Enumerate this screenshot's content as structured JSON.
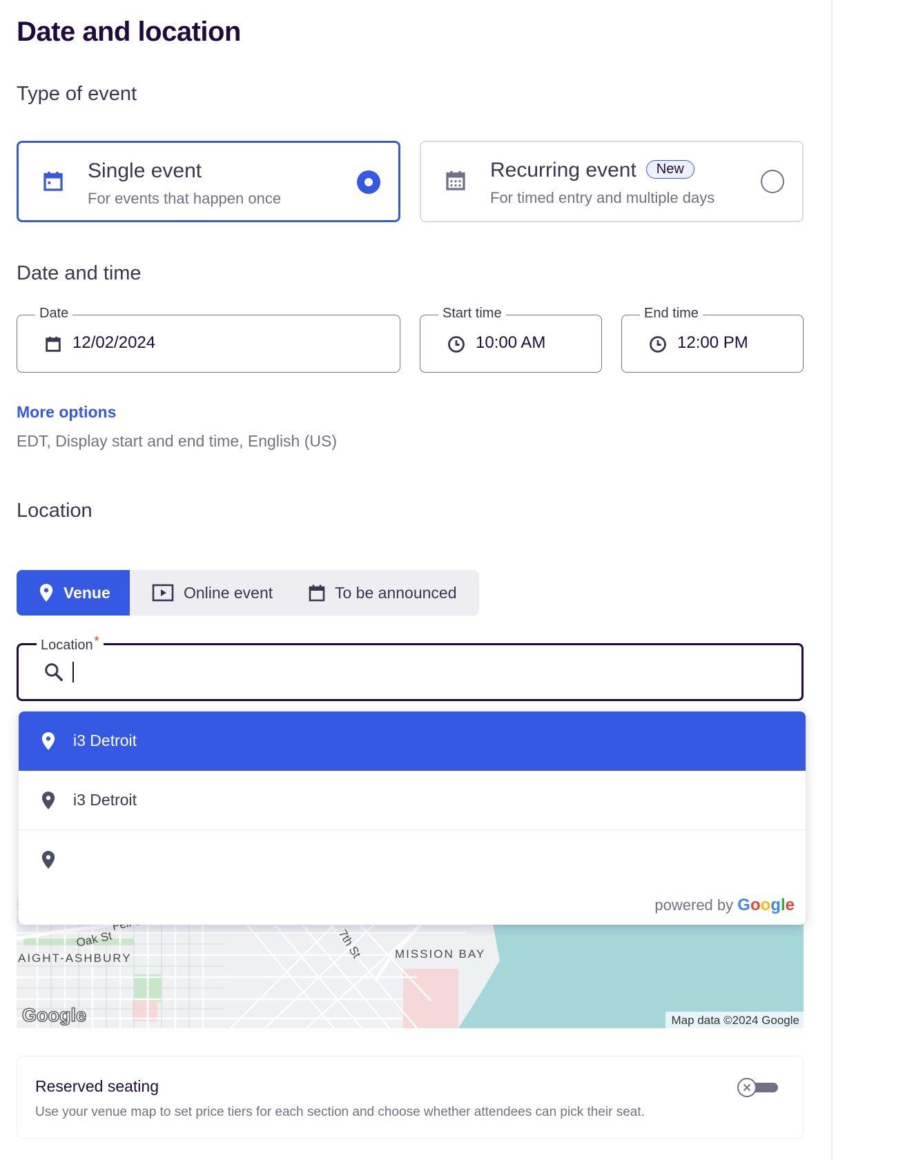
{
  "page": {
    "title": "Date and location"
  },
  "event_type": {
    "section_title": "Type of event",
    "options": [
      {
        "title": "Single event",
        "subtitle": "For events that happen once",
        "selected": true
      },
      {
        "title": "Recurring event",
        "badge": "New",
        "subtitle": "For timed entry and multiple days",
        "selected": false
      }
    ]
  },
  "date_time": {
    "section_title": "Date and time",
    "date": {
      "label": "Date",
      "value": "12/02/2024"
    },
    "start_time": {
      "label": "Start time",
      "value": "10:00 AM"
    },
    "end_time": {
      "label": "End time",
      "value": "12:00 PM"
    },
    "more_options": "More options",
    "summary": "EDT, Display start and end time, English (US)"
  },
  "location": {
    "section_title": "Location",
    "tabs": [
      {
        "label": "Venue",
        "active": true,
        "icon": "pin-icon"
      },
      {
        "label": "Online event",
        "active": false,
        "icon": "video-icon"
      },
      {
        "label": "To be announced",
        "active": false,
        "icon": "calendar-icon"
      }
    ],
    "input": {
      "label": "Location",
      "required_mark": "*",
      "value": ""
    },
    "suggestions": [
      {
        "label": "i3 Detroit",
        "highlighted": true
      },
      {
        "label": "i3 Detroit",
        "highlighted": false
      },
      {
        "label": "",
        "highlighted": false
      }
    ],
    "powered_by": "powered by",
    "powered_brand": "Google"
  },
  "map": {
    "labels": {
      "street1": "Fell St",
      "street2": "Oak St",
      "street3": "7th St",
      "area1": "AIGHT-ASHBURY",
      "area2": "MISSION BAY"
    },
    "logo": "Google",
    "attribution": "Map data ©2024 Google"
  },
  "reserved_seating": {
    "title": "Reserved seating",
    "description": "Use your venue map to set price tiers for each section and choose whether attendees can pick their seat.",
    "enabled": false
  },
  "colors": {
    "primary": "#3659e3",
    "text_dark": "#1e0a3c",
    "text_muted": "#6f7287",
    "border": "#dbdae3"
  }
}
